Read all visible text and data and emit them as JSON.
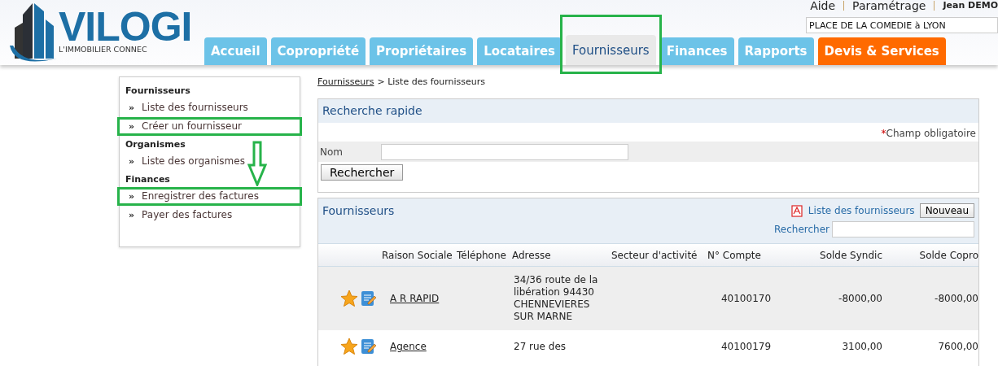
{
  "top_links": [
    "Aide",
    "Paramétrage",
    "Jean DEMO"
  ],
  "building_field": {
    "value": "PLACE DE LA COMEDIE à LYON"
  },
  "logo": {
    "name": "VILOGI",
    "tagline": "L'IMMOBILIER CONNEC"
  },
  "tabs": [
    {
      "label": "Accueil",
      "selected": false,
      "kind": "normal",
      "highlighted": false
    },
    {
      "label": "Copropriété",
      "selected": false,
      "kind": "normal",
      "highlighted": false
    },
    {
      "label": "Propriétaires",
      "selected": false,
      "kind": "normal",
      "highlighted": false
    },
    {
      "label": "Locataires",
      "selected": false,
      "kind": "normal",
      "highlighted": false
    },
    {
      "label": "Fournisseurs",
      "selected": true,
      "kind": "normal",
      "highlighted": true
    },
    {
      "label": "Finances",
      "selected": false,
      "kind": "normal",
      "highlighted": false
    },
    {
      "label": "Rapports",
      "selected": false,
      "kind": "normal",
      "highlighted": false
    },
    {
      "label": "Devis & Services",
      "selected": false,
      "kind": "accent",
      "highlighted": false
    }
  ],
  "sidebar": {
    "sections": [
      {
        "title": "Fournisseurs",
        "items": [
          {
            "label": "Liste des fournisseurs",
            "highlighted": false
          },
          {
            "label": "Créer un fournisseur",
            "highlighted": true
          }
        ]
      },
      {
        "title": "Organismes",
        "items": [
          {
            "label": "Liste des organismes",
            "highlighted": false
          }
        ]
      },
      {
        "title": "Finances",
        "items": [
          {
            "label": "Enregistrer des factures",
            "highlighted": true
          },
          {
            "label": "Payer des factures",
            "highlighted": false
          }
        ]
      }
    ],
    "bullet": "»"
  },
  "breadcrumb": {
    "link": "Fournisseurs",
    "separator": ">",
    "current": "Liste des fournisseurs"
  },
  "quick_search": {
    "title": "Recherche rapide",
    "required_mark": "*",
    "required_note": "Champ obligatoire",
    "field_label": "Nom",
    "button": "Rechercher"
  },
  "suppliers_panel": {
    "title": "Fournisseurs",
    "pdf_link": "Liste des fournisseurs",
    "new_button": "Nouveau",
    "search_label": "Rechercher",
    "columns": [
      "Raison Sociale",
      "Téléphone",
      "Adresse",
      "Secteur d'activité",
      "N° Compte",
      "Solde Syndic",
      "Solde Copro"
    ],
    "rows": [
      {
        "name": "A R RAPID",
        "phone": "",
        "address": "34/36 route de la libération 94430 CHENNEVIERES SUR MARNE",
        "sector": "",
        "account": "40100170",
        "solde_syndic": "-8000,00",
        "solde_copro": "-8000,00"
      },
      {
        "name": "Agence",
        "phone": "",
        "address": "27 rue des",
        "sector": "",
        "account": "40100179",
        "solde_syndic": "3100,00",
        "solde_copro": "7600,00"
      }
    ]
  }
}
